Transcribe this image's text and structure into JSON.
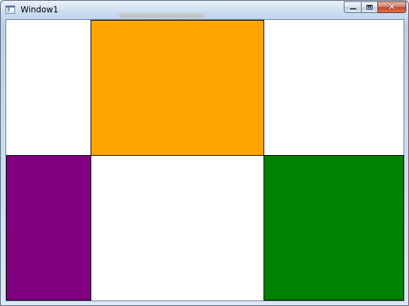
{
  "window": {
    "title": "Window1",
    "icon": "window-app-icon",
    "controls": {
      "minimize_icon": "minimize-icon",
      "maximize_icon": "maximize-icon",
      "close_icon": "close-icon",
      "close_glyph": "✕"
    }
  },
  "grid": {
    "cells": [
      {
        "name": "orange-cell",
        "color": "#FFA500"
      },
      {
        "name": "purple-cell",
        "color": "#800080"
      },
      {
        "name": "green-cell",
        "color": "#008000"
      }
    ]
  }
}
